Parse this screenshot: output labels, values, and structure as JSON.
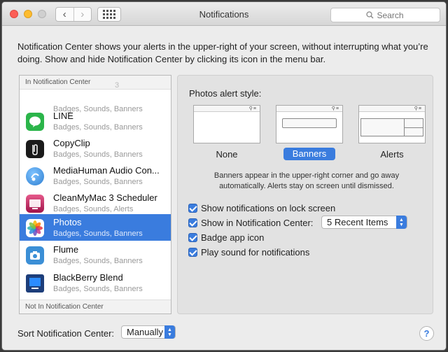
{
  "window": {
    "title": "Notifications",
    "search_placeholder": "Search",
    "back": "‹",
    "forward": "›"
  },
  "intro": "Notification Center shows your alerts in the upper-right of your screen, without interrupting what you’re doing. Show and hide Notification Center by clicking its icon in the menu bar.",
  "sidebar": {
    "in_header": "In Notification Center",
    "out_header": "Not In Notification Center",
    "partial_item_suffix": "3",
    "apps": [
      {
        "name": "",
        "detail": "Badges, Sounds, Banners",
        "icon": "partial-app-icon",
        "color": "#cccccc"
      },
      {
        "name": "LINE",
        "detail": "Badges, Sounds, Banners",
        "icon": "line-icon",
        "color": "#2bb54a"
      },
      {
        "name": "CopyClip",
        "detail": "Badges, Sounds, Banners",
        "icon": "copyclip-icon",
        "color": "#1a1a1a"
      },
      {
        "name": "MediaHuman Audio Con...",
        "detail": "Badges, Sounds, Banners",
        "icon": "mediahuman-icon",
        "color": "#2f7fd1"
      },
      {
        "name": "CleanMyMac 3 Scheduler",
        "detail": "Badges, Sounds, Alerts",
        "icon": "cleanmymac-icon",
        "color": "#c2185b"
      },
      {
        "name": "Photos",
        "detail": "Badges, Sounds, Banners",
        "icon": "photos-icon",
        "color": "#f4f4f4"
      },
      {
        "name": "Flume",
        "detail": "Badges, Sounds, Banners",
        "icon": "flume-icon",
        "color": "#3b8fd6"
      },
      {
        "name": "BlackBerry Blend",
        "detail": "Badges, Sounds, Banners",
        "icon": "blackberry-icon",
        "color": "#1d3e7a"
      }
    ],
    "selected_index": 5
  },
  "panel": {
    "alert_style_label": "Photos alert style:",
    "styles": [
      {
        "label": "None",
        "selected": false
      },
      {
        "label": "Banners",
        "selected": true
      },
      {
        "label": "Alerts",
        "selected": false
      }
    ],
    "style_description": "Banners appear in the upper-right corner and go away automatically. Alerts stay on screen until dismissed.",
    "options": [
      {
        "label": "Show notifications on lock screen",
        "checked": true
      },
      {
        "label": "Show in Notification Center:",
        "checked": true
      },
      {
        "label": "Badge app icon",
        "checked": true
      },
      {
        "label": "Play sound for notifications",
        "checked": true
      }
    ],
    "recent_items_value": "5 Recent Items"
  },
  "footer": {
    "sort_label": "Sort Notification Center:",
    "sort_value": "Manually",
    "help": "?"
  },
  "colors": {
    "accent": "#3a7cde"
  }
}
